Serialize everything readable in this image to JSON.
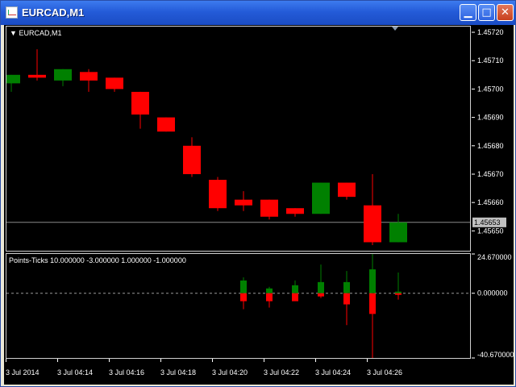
{
  "window": {
    "title": "EURCAD,M1",
    "buttons": [
      "minimize",
      "maximize",
      "close"
    ]
  },
  "main": {
    "symbol": "EURCAD,M1",
    "price_ticks": [
      "1.45720",
      "1.45710",
      "1.45700",
      "1.45690",
      "1.45680",
      "1.45670",
      "1.45660",
      "1.45650"
    ],
    "current_price": "1.45653"
  },
  "indicator": {
    "label": "Points-Ticks  10.000000 -3.000000 1.000000 -1.000000",
    "ticks": [
      "24.670000",
      "0.000000",
      "-40.670000"
    ]
  },
  "time_axis": [
    "3 Jul 2014",
    "3 Jul 04:14",
    "3 Jul 04:16",
    "3 Jul 04:18",
    "3 Jul 04:20",
    "3 Jul 04:22",
    "3 Jul 04:24",
    "3 Jul 04:26"
  ],
  "colors": {
    "bull": "#008000",
    "bear": "#ff0000",
    "background": "#000000",
    "axis": "#ffffff"
  },
  "chart_data": [
    {
      "type": "candlestick",
      "title": "EURCAD,M1",
      "ylim": [
        1.45643,
        1.45722
      ],
      "current_price": 1.45653,
      "grid": false,
      "candles": [
        {
          "open": 1.45702,
          "high": 1.45705,
          "low": 1.45699,
          "close": 1.45705
        },
        {
          "open": 1.45705,
          "high": 1.45714,
          "low": 1.45703,
          "close": 1.45704
        },
        {
          "open": 1.45703,
          "high": 1.45707,
          "low": 1.45701,
          "close": 1.45707
        },
        {
          "open": 1.45706,
          "high": 1.45707,
          "low": 1.45699,
          "close": 1.45703
        },
        {
          "open": 1.45704,
          "high": 1.45704,
          "low": 1.45699,
          "close": 1.457
        },
        {
          "open": 1.45699,
          "high": 1.45699,
          "low": 1.45686,
          "close": 1.45691
        },
        {
          "open": 1.4569,
          "high": 1.4569,
          "low": 1.45685,
          "close": 1.45685
        },
        {
          "open": 1.4568,
          "high": 1.45683,
          "low": 1.45669,
          "close": 1.4567
        },
        {
          "open": 1.45668,
          "high": 1.45669,
          "low": 1.45657,
          "close": 1.45658
        },
        {
          "open": 1.45661,
          "high": 1.45664,
          "low": 1.45657,
          "close": 1.45659
        },
        {
          "open": 1.45661,
          "high": 1.45661,
          "low": 1.45654,
          "close": 1.45655
        },
        {
          "open": 1.45658,
          "high": 1.45658,
          "low": 1.45655,
          "close": 1.45656
        },
        {
          "open": 1.45656,
          "high": 1.45667,
          "low": 1.45656,
          "close": 1.45667
        },
        {
          "open": 1.45667,
          "high": 1.45667,
          "low": 1.45661,
          "close": 1.45662
        },
        {
          "open": 1.45659,
          "high": 1.4567,
          "low": 1.45645,
          "close": 1.45646
        },
        {
          "open": 1.45646,
          "high": 1.45656,
          "low": 1.45646,
          "close": 1.45653
        }
      ]
    },
    {
      "type": "bar",
      "title": "Points-Ticks",
      "ylim": [
        -40.67,
        24.67
      ],
      "zero_line": 0,
      "candles": [
        {
          "index": 9,
          "up": 8,
          "down": -5,
          "high": 10,
          "low": -10
        },
        {
          "index": 10,
          "up": 3,
          "down": -5,
          "high": 4,
          "low": -9
        },
        {
          "index": 11,
          "up": 5,
          "down": -5,
          "high": 8,
          "low": -4
        },
        {
          "index": 12,
          "up": 7,
          "down": -2,
          "high": 18,
          "low": -3
        },
        {
          "index": 13,
          "up": 7,
          "down": -7,
          "high": 14,
          "low": -20
        },
        {
          "index": 14,
          "up": 15,
          "down": -13,
          "high": 25,
          "low": -43
        },
        {
          "index": 15,
          "up": 1,
          "down": -1,
          "high": 13,
          "low": -4
        }
      ]
    }
  ]
}
